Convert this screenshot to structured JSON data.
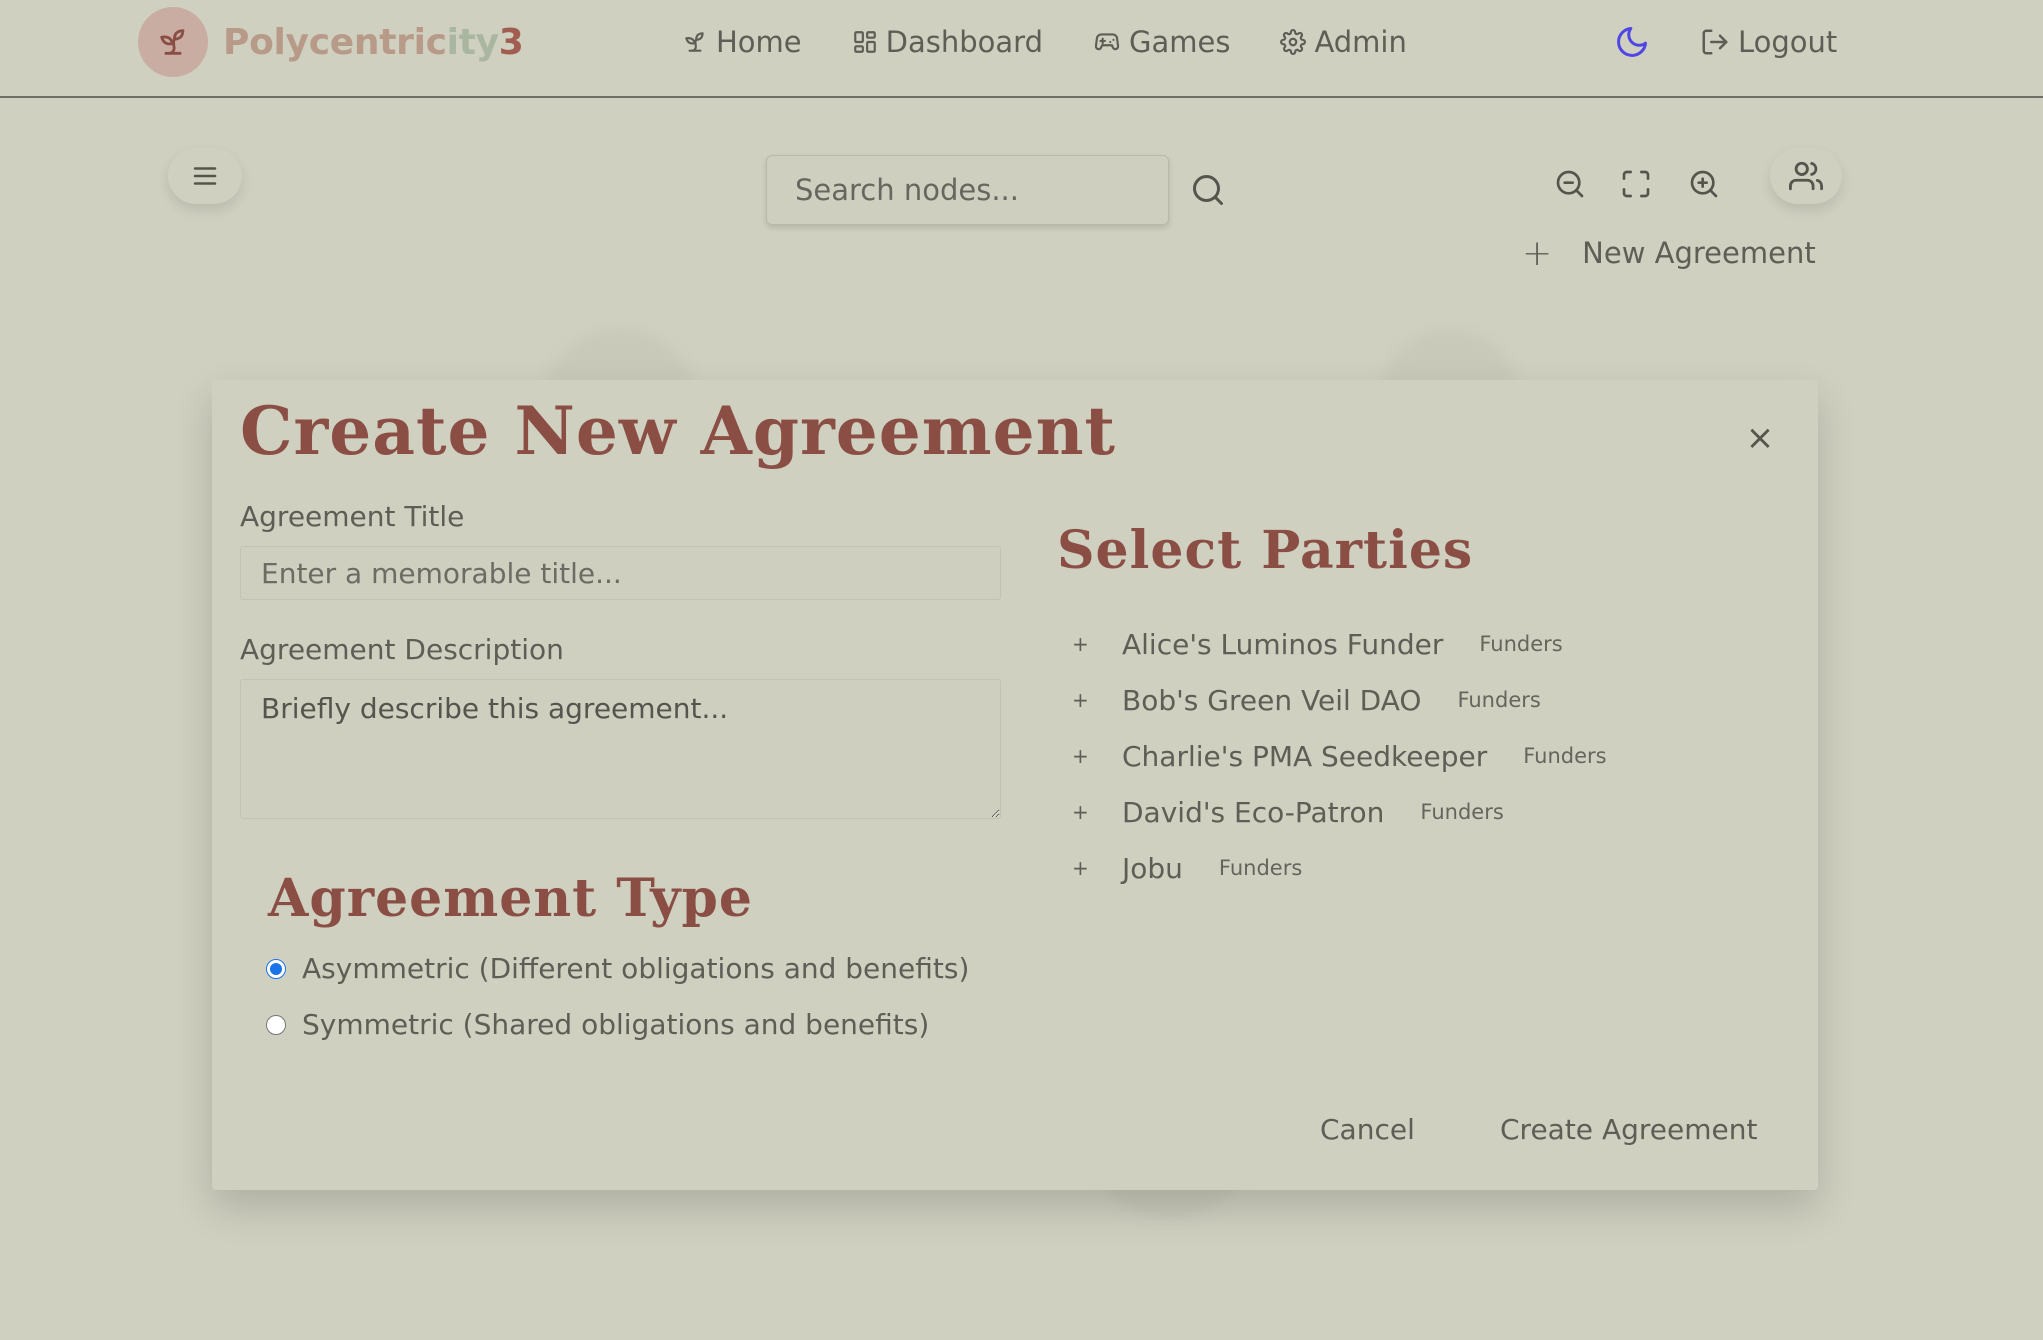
{
  "navbar": {
    "brand_part1": "Polycentric",
    "brand_part2": "ity",
    "brand_part3": "3",
    "links": [
      {
        "label": "Home",
        "icon": "sprout-icon"
      },
      {
        "label": "Dashboard",
        "icon": "dashboard-icon"
      },
      {
        "label": "Games",
        "icon": "gamepad-icon"
      },
      {
        "label": "Admin",
        "icon": "gear-icon"
      }
    ],
    "theme_icon": "moon-icon",
    "logout_label": "Logout"
  },
  "toolbar": {
    "search_placeholder": "Search nodes...",
    "new_agreement_label": "New Agreement"
  },
  "modal": {
    "title": "Create New Agreement",
    "close_symbol": "×",
    "agreement_title_label": "Agreement Title",
    "agreement_title_placeholder": "Enter a memorable title...",
    "agreement_description_label": "Agreement Description",
    "agreement_description_placeholder": "Briefly describe this agreement...",
    "agreement_type_title": "Agreement Type",
    "type_options": [
      {
        "label": "Asymmetric (Different obligations and benefits)",
        "checked": true
      },
      {
        "label": "Symmetric (Shared obligations and benefits)",
        "checked": false
      }
    ],
    "select_parties_title": "Select Parties",
    "parties": [
      {
        "name": "Alice's Luminos Funder",
        "group": "Funders"
      },
      {
        "name": "Bob's Green Veil DAO",
        "group": "Funders"
      },
      {
        "name": "Charlie's PMA Seedkeeper",
        "group": "Funders"
      },
      {
        "name": "David's Eco-Patron",
        "group": "Funders"
      },
      {
        "name": "Jobu",
        "group": "Funders"
      }
    ],
    "add_symbol": "+",
    "cancel_label": "Cancel",
    "create_label": "Create Agreement"
  },
  "colors": {
    "background": "#d0d0c1",
    "heading": "#8a4e44",
    "text": "#5e5e56",
    "moon_accent": "#4f46e5",
    "radio_accent": "#1a73e8"
  }
}
